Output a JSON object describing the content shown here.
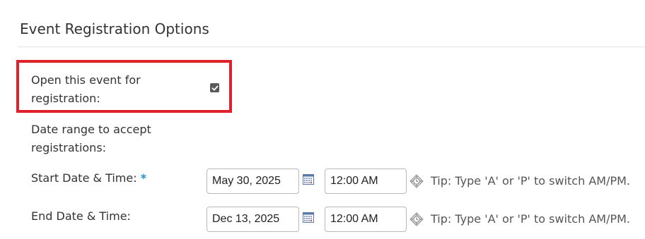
{
  "section": {
    "title": "Event Registration Options"
  },
  "open_registration": {
    "label_line1": "Open this event for",
    "label_line2": "registration:",
    "checked": true
  },
  "date_range": {
    "label_line1": "Date range to accept",
    "label_line2": "registrations:"
  },
  "start": {
    "label": "Start Date & Time:",
    "required_mark": "*",
    "date": "May 30, 2025",
    "time": "12:00 AM",
    "tip": "Tip: Type 'A' or 'P' to switch AM/PM."
  },
  "end": {
    "label": "End Date & Time:",
    "date": "Dec 13, 2025",
    "time": "12:00 AM",
    "tip": "Tip: Type 'A' or 'P' to switch AM/PM."
  },
  "colors": {
    "highlight": "#e0202a",
    "required": "#1a8fd6"
  },
  "icons": {
    "calendar": "calendar-icon",
    "time_picker": "time-picker-icon",
    "check": "check-icon"
  }
}
